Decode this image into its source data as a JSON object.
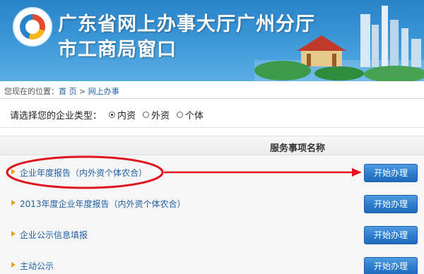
{
  "header": {
    "title_line1": "广东省网上办事大厅广州分厅",
    "title_line2": "市工商局窗口"
  },
  "breadcrumb": {
    "prefix": "您现在的位置：",
    "home": "首 页",
    "separator": " > ",
    "current": "网上办事"
  },
  "selector": {
    "label": "请选择您的企业类型：",
    "options": [
      {
        "label": "内资",
        "checked": true
      },
      {
        "label": "外资",
        "checked": false
      },
      {
        "label": "个体",
        "checked": false
      }
    ]
  },
  "services": {
    "column_header": "服务事项名称",
    "items": [
      {
        "label": "企业年度报告（内外资个体农合）",
        "action": "开始办理"
      },
      {
        "label": "2013年度企业年度报告（内外资个体农合）",
        "action": "开始办理"
      },
      {
        "label": "企业公示信息填报",
        "action": "开始办理"
      },
      {
        "label": "主动公示",
        "action": "开始办理"
      }
    ]
  },
  "colors": {
    "banner": "#2a83c8",
    "link": "#1f5fa5",
    "button": "#2f7fcf",
    "annotation": "#e0141c",
    "bullet": "#e8a21a"
  }
}
